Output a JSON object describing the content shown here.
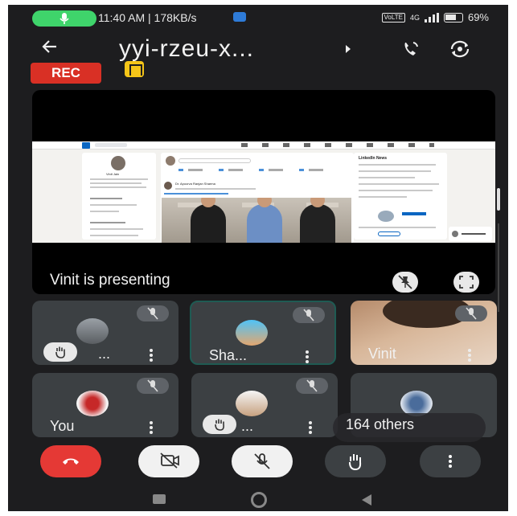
{
  "status_bar": {
    "time_and_speed": "11:40 AM | 178KB/s",
    "network": "4G",
    "volte": "VoLTE",
    "battery": "69%"
  },
  "header": {
    "title": "yyi-rzeu-x...",
    "rec_label": "REC"
  },
  "presentation": {
    "presenter_label": "Vinit is presenting",
    "linkedin": {
      "profile_name": "Vinit Jain",
      "news_title": "LinkedIn News",
      "post_author": "Dr. Apoorva Ranjan Sharma"
    }
  },
  "participants": [
    {
      "name": "...",
      "hand_raised": true,
      "muted": true,
      "active": false
    },
    {
      "name": "Sha...",
      "hand_raised": false,
      "muted": true,
      "active": true
    },
    {
      "name": "Vinit",
      "hand_raised": false,
      "muted": true,
      "active": false
    },
    {
      "name": "You",
      "hand_raised": false,
      "muted": true,
      "active": false
    },
    {
      "name": "...",
      "hand_raised": true,
      "muted": true,
      "active": false
    },
    {
      "name": "164 others",
      "hand_raised": false,
      "muted": false,
      "active": false
    }
  ],
  "controls": {
    "end_call": "end-call-icon",
    "camera": "camera-off-icon",
    "mic": "mic-off-icon",
    "hand": "raise-hand-icon",
    "more": "more-vert-icon"
  },
  "colors": {
    "background": "#1d1d1f",
    "tile": "#3c4043",
    "rec": "#d93025",
    "end_call": "#e53935",
    "active_border": "#1f5b53",
    "mic_pill": "#3fd46b"
  }
}
